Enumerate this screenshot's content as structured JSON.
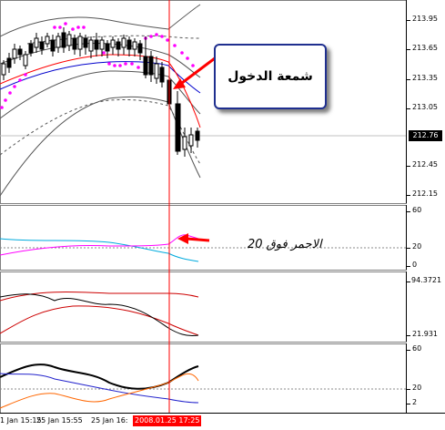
{
  "price_pane": {
    "ticks": [
      "213.95",
      "213.65",
      "213.35",
      "213.05",
      "212.45",
      "212.15"
    ],
    "current_price": "212.76"
  },
  "indicator1": {
    "ticks": [
      "60",
      "20",
      "0"
    ]
  },
  "indicator2": {
    "ticks": [
      "94.3721",
      "21.931"
    ]
  },
  "indicator3": {
    "ticks": [
      "60",
      "20",
      "2"
    ]
  },
  "time_axis": {
    "labels": [
      "1 Jan 15:15",
      "25 Jan 15:55",
      "25 Jan 16:"
    ],
    "highlight": "2008.01.25 17:25"
  },
  "annotations": {
    "entry_candle": "شمعة الدخول",
    "red_above_20": "الاحمر فوق 20"
  },
  "colors": {
    "crosshair": "#ff0000",
    "annotation_border": "#1f2f8f",
    "upper_band": "#555555",
    "middle_blue": "#0000cc",
    "psar_dots": "#ff00ff"
  }
}
